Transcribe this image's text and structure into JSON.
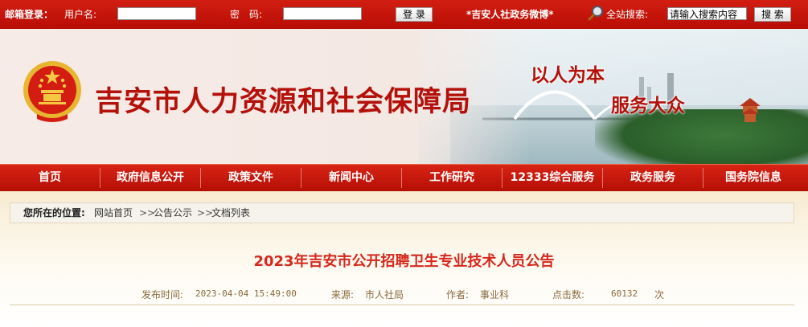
{
  "topbar": {
    "mailbox_login_label": "邮箱登录：",
    "username_label": "用户名:",
    "password_label": "密　码:",
    "login_button": "登 录",
    "weibo_link": "*吉安人社政务微博*",
    "search_label": "全站搜索:",
    "search_value": "请输入搜索内容",
    "search_button": "搜 索"
  },
  "banner": {
    "site_title": "吉安市人力资源和社会保障局",
    "slogan_line1": "以人为本",
    "slogan_line2": "服务大众"
  },
  "nav": {
    "items": [
      "首页",
      "政府信息公开",
      "政策文件",
      "新闻中心",
      "工作研究",
      "12333综合服务",
      "政务服务",
      "国务院信息"
    ]
  },
  "breadcrumb": {
    "label": "您所在的位置:",
    "items": [
      "网站首页",
      "公告公示",
      "文档列表"
    ],
    "separator": ">>"
  },
  "article": {
    "title": "2023年吉安市公开招聘卫生专业技术人员公告",
    "publish_time_label": "发布时间:",
    "publish_time": "2023-04-04 15:49:00",
    "source_label": "来源:",
    "source": "市人社局",
    "author_label": "作者:",
    "author": "事业科",
    "clicks_label": "点击数:",
    "clicks": "60132",
    "clicks_unit": "次"
  },
  "colors": {
    "brand_red": "#b3110a",
    "title_red": "#d7281c",
    "nav_red": "#c8180b"
  }
}
